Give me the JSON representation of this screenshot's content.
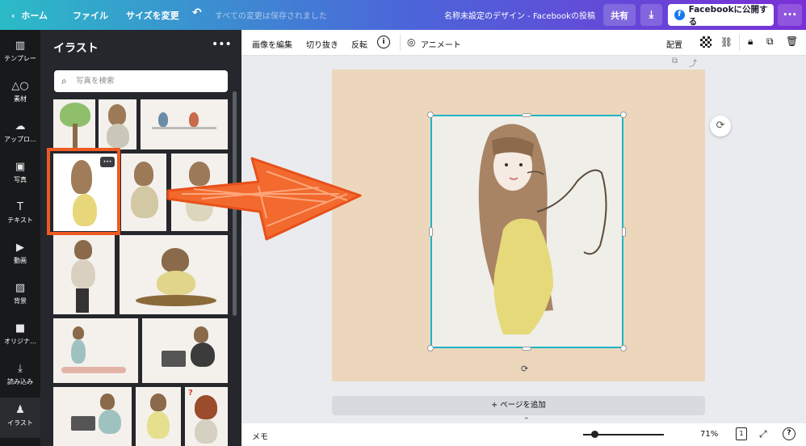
{
  "topbar": {
    "home": "ホーム",
    "file": "ファイル",
    "resize": "サイズを変更",
    "saved_status": "すべての変更は保存されました",
    "design_title": "名称未設定のデザイン - Facebookの投稿",
    "share": "共有",
    "publish": "Facebookに公開する",
    "more": "•••"
  },
  "sidebar": {
    "items": [
      {
        "label": "テンプレー",
        "icon": "template-icon"
      },
      {
        "label": "素材",
        "icon": "elements-icon"
      },
      {
        "label": "アップロ…",
        "icon": "upload-icon"
      },
      {
        "label": "写真",
        "icon": "photo-icon"
      },
      {
        "label": "テキスト",
        "icon": "text-icon"
      },
      {
        "label": "動画",
        "icon": "video-icon"
      },
      {
        "label": "背景",
        "icon": "background-icon"
      },
      {
        "label": "オリジナ…",
        "icon": "original-icon"
      },
      {
        "label": "読み込み",
        "icon": "import-icon"
      },
      {
        "label": "イラスト",
        "icon": "illustration-icon"
      }
    ]
  },
  "panel": {
    "title": "イラスト",
    "more": "•••",
    "search_placeholder": "写真を検索",
    "thumb_more": "•••"
  },
  "toolbar": {
    "edit_image": "画像を編集",
    "crop": "切り抜き",
    "flip": "反転",
    "info": "i",
    "animate": "アニメート",
    "position": "配置"
  },
  "canvas": {
    "add_page": "+ ページを追加"
  },
  "bottombar": {
    "memo": "メモ",
    "zoom": "71%",
    "page_number": "1",
    "help": "?"
  },
  "colors": {
    "accent_teal": "#1fb4c5",
    "annotation_orange": "#ee5a24",
    "page_bg": "#ecd7bd"
  }
}
